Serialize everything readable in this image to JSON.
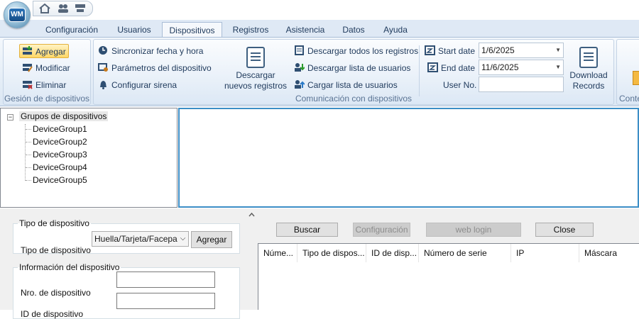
{
  "app": {
    "logo_text": "WM"
  },
  "tabs": [
    {
      "label": "Configuración"
    },
    {
      "label": "Usuarios"
    },
    {
      "label": "Dispositivos",
      "active": true
    },
    {
      "label": "Registros"
    },
    {
      "label": "Asistencia"
    },
    {
      "label": "Datos"
    },
    {
      "label": "Ayuda"
    }
  ],
  "ribbon": {
    "device_mgmt": {
      "label": "Gesión de dispositivos",
      "add": "Agregar",
      "modify": "Modificar",
      "delete": "Eliminar"
    },
    "comm": {
      "label": "Comunicación con dispositivos",
      "sync_time": "Sincronizar fecha y hora",
      "device_params": "Parámetros del dispositivo",
      "config_siren": "Configurar sirena",
      "download_new_line1": "Descargar",
      "download_new_line2": "nuevos registros",
      "download_all": "Descargar todos los registros",
      "download_users": "Descargar lista de usuarios",
      "upload_users": "Cargar lista de usuarios",
      "start_date_label": "Start date",
      "start_date_value": "1/6/2025",
      "end_date_label": "End date",
      "end_date_value": "11/6/2025",
      "user_no_label": "User No.",
      "user_no_value": "",
      "download_records_line1": "Download",
      "download_records_line2": "Records"
    },
    "partial_group_label": "Conte"
  },
  "tree": {
    "root": "Grupos de dispositivos",
    "toggle": "−",
    "children": [
      "DeviceGroup1",
      "DeviceGroup2",
      "DeviceGroup3",
      "DeviceGroup4",
      "DeviceGroup5"
    ]
  },
  "device_type": {
    "legend": "Tipo de dispositivo",
    "label": "Tipo de dispositivo",
    "selected": "Huella/Tarjeta/Facepass",
    "add_button": "Agregar"
  },
  "device_info": {
    "legend": "Información del dispositivo",
    "number_label": "Nro. de dispositivo",
    "number_value": "",
    "id_label": "ID de dispositivo",
    "id_value": ""
  },
  "search_panel": {
    "search": "Buscar",
    "config": "Configuración",
    "web_login": "web login",
    "close": "Close"
  },
  "grid": {
    "columns": [
      "Núme...",
      "Tipo de dispos...",
      "ID de disp...",
      "Número de serie",
      "IP",
      "Máscara"
    ]
  },
  "colors": {
    "accent": "#3c8ec6",
    "ribbon_text": "#1e395b",
    "selected": "#ffd767"
  }
}
